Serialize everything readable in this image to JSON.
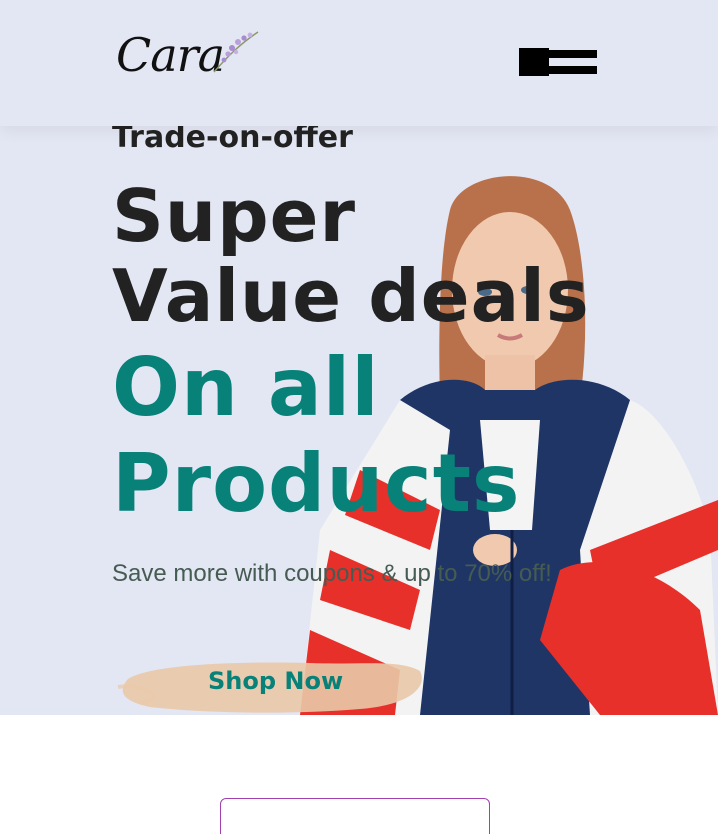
{
  "header": {
    "logo_text": "Cara",
    "menu_icon": "hamburger-menu-icon"
  },
  "hero": {
    "subhead": "Trade-on-offer",
    "headline": "Super Value deals",
    "headline_accent": "On all Products",
    "tagline": "Save more with coupons & up to 70% off!",
    "cta_label": "Shop Now"
  },
  "colors": {
    "hero_background": "#e3e6f3",
    "accent": "#088178",
    "heading": "#222222",
    "button_brush": "#e9c9a8",
    "outline_accent": "#a340b0"
  }
}
